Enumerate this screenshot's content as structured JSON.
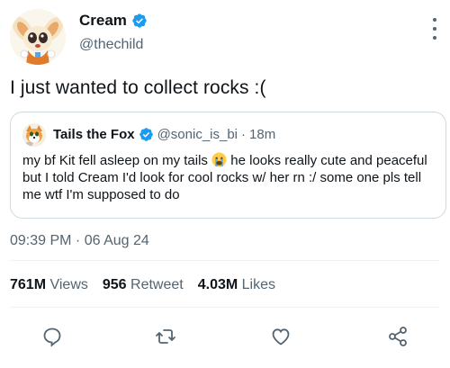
{
  "author": {
    "display_name": "Cream",
    "handle": "@thechild",
    "verified": true,
    "avatar_icon": "cream-rabbit-avatar"
  },
  "tweet": {
    "text": "I just wanted to collect rocks :("
  },
  "quoted_tweet": {
    "display_name": "Tails the Fox",
    "handle": "@sonic_is_bi",
    "separator": "·",
    "time": "18m",
    "verified": true,
    "avatar_icon": "tails-fox-avatar",
    "text_before_emoji": "my bf Kit fell asleep on my tails ",
    "emoji": "crying-face-icon",
    "text_after_emoji": " he looks really cute and peaceful but I told Cream I'd look for cool rocks w/ her rn :/ some one pls tell me wtf I'm supposed to do"
  },
  "timestamp": "09:39 PM · 06 Aug 24",
  "stats": {
    "views_count": "761M",
    "views_label": "Views",
    "retweets_count": "956",
    "retweets_label": "Retweet",
    "likes_count": "4.03M",
    "likes_label": "Likes"
  },
  "actions": [
    "reply-icon",
    "retweet-icon",
    "like-icon",
    "share-icon"
  ],
  "colors": {
    "verified_blue": "#1d9bf0",
    "secondary_text": "#536471",
    "border": "#cfd9de"
  }
}
